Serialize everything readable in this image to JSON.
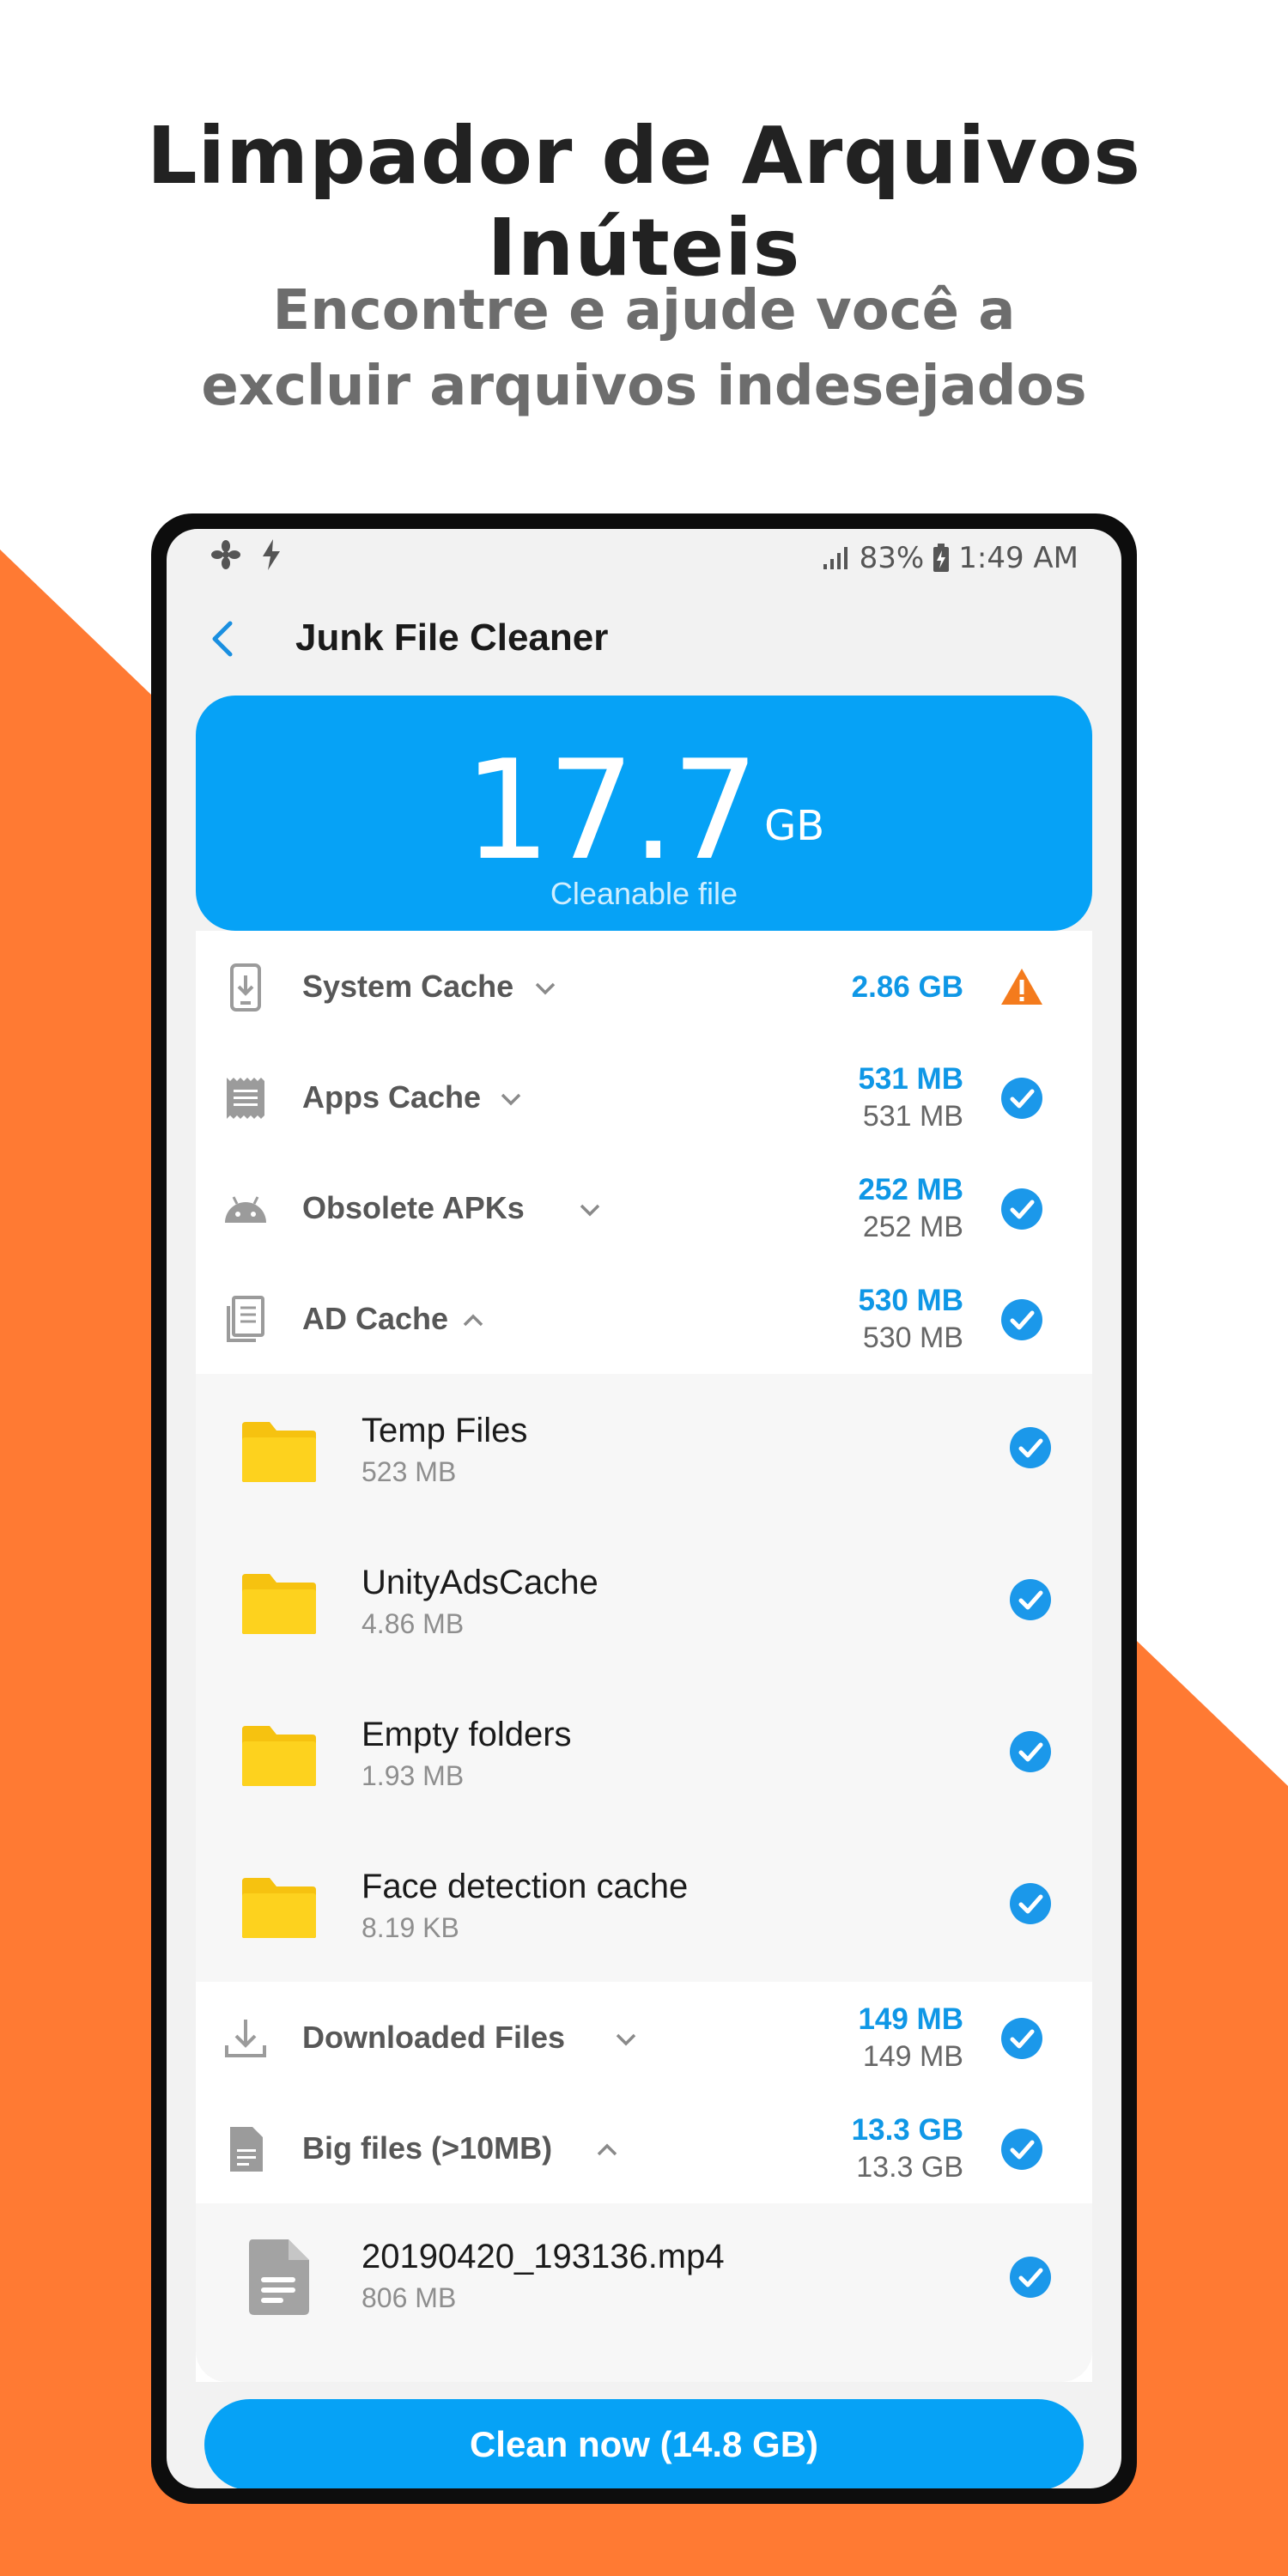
{
  "promo": {
    "title": "Limpador de Arquivos Inúteis",
    "subtitle_line1": "Encontre e ajude você a",
    "subtitle_line2": "excluir arquivos indesejados",
    "accent_color": "#ff7a33"
  },
  "status_bar": {
    "battery": "83%",
    "time": "1:49 AM"
  },
  "app": {
    "title": "Junk File Cleaner",
    "primary_color": "#06a2f6"
  },
  "summary": {
    "value": "17.7",
    "unit": "GB",
    "label": "Cleanable file"
  },
  "categories": [
    {
      "name": "System Cache",
      "icon": "phone-download-icon",
      "size_primary": "2.86 GB",
      "size_secondary": "",
      "status": "warning"
    },
    {
      "name": "Apps Cache",
      "icon": "receipt-icon",
      "size_primary": "531 MB",
      "size_secondary": "531 MB",
      "status": "checked"
    },
    {
      "name": "Obsolete APKs",
      "icon": "android-icon",
      "size_primary": "252 MB",
      "size_secondary": "252 MB",
      "status": "checked"
    },
    {
      "name": "AD Cache",
      "icon": "document-stack-icon",
      "size_primary": "530 MB",
      "size_secondary": "530 MB",
      "status": "checked",
      "expanded": true
    },
    {
      "name": "Downloaded Files",
      "icon": "download-icon",
      "size_primary": "149 MB",
      "size_secondary": "149 MB",
      "status": "checked"
    },
    {
      "name": "Big files (>10MB)",
      "icon": "file-icon",
      "size_primary": "13.3 GB",
      "size_secondary": "13.3 GB",
      "status": "checked",
      "expanded": true
    }
  ],
  "ad_cache_items": [
    {
      "name": "Temp Files",
      "size": "523 MB"
    },
    {
      "name": "UnityAdsCache",
      "size": "4.86 MB"
    },
    {
      "name": "Empty folders",
      "size": "1.93 MB"
    },
    {
      "name": "Face detection cache",
      "size": "8.19 KB"
    }
  ],
  "big_files_items": [
    {
      "name": "20190420_193136.mp4",
      "size": "806 MB"
    }
  ],
  "clean_button": "Clean now (14.8 GB)"
}
